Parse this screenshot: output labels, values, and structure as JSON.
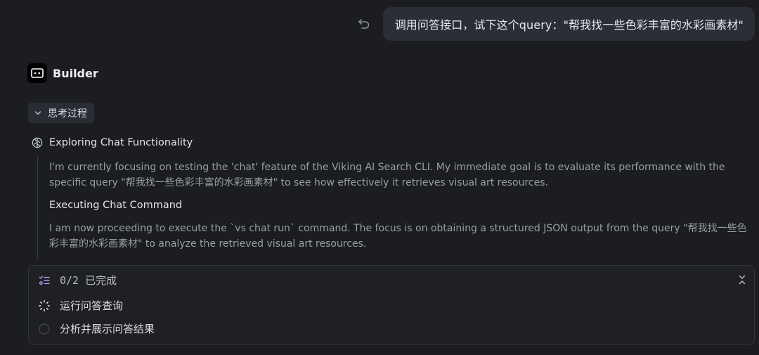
{
  "user_message": {
    "text": "调用问答接口，试下这个query：\"帮我找一些色彩丰富的水彩画素材\""
  },
  "assistant": {
    "name": "Builder"
  },
  "thinking": {
    "toggle_label": "思考过程",
    "section1": {
      "title": "Exploring Chat Functionality",
      "body": "I'm currently focusing on testing the 'chat' feature of the Viking AI Search CLI. My immediate goal is to evaluate its performance with the specific query \"帮我找一些色彩丰富的水彩画素材\" to see how effectively it retrieves visual art resources."
    },
    "section2": {
      "title": "Executing Chat Command",
      "body": "I am now proceeding to execute the `vs chat run` command. The focus is on obtaining a structured JSON output from the query \"帮我找一些色彩丰富的水彩画素材\" to analyze the retrieved visual art resources."
    }
  },
  "tasks": {
    "progress": "0/2 已完成",
    "items": [
      {
        "label": "运行问答查询",
        "status": "in-progress"
      },
      {
        "label": "分析并展示问答结果",
        "status": "pending"
      }
    ]
  },
  "colors": {
    "background": "#1b1d21",
    "bubble": "#2b2e35",
    "accent_icon": "#a89bf0"
  }
}
